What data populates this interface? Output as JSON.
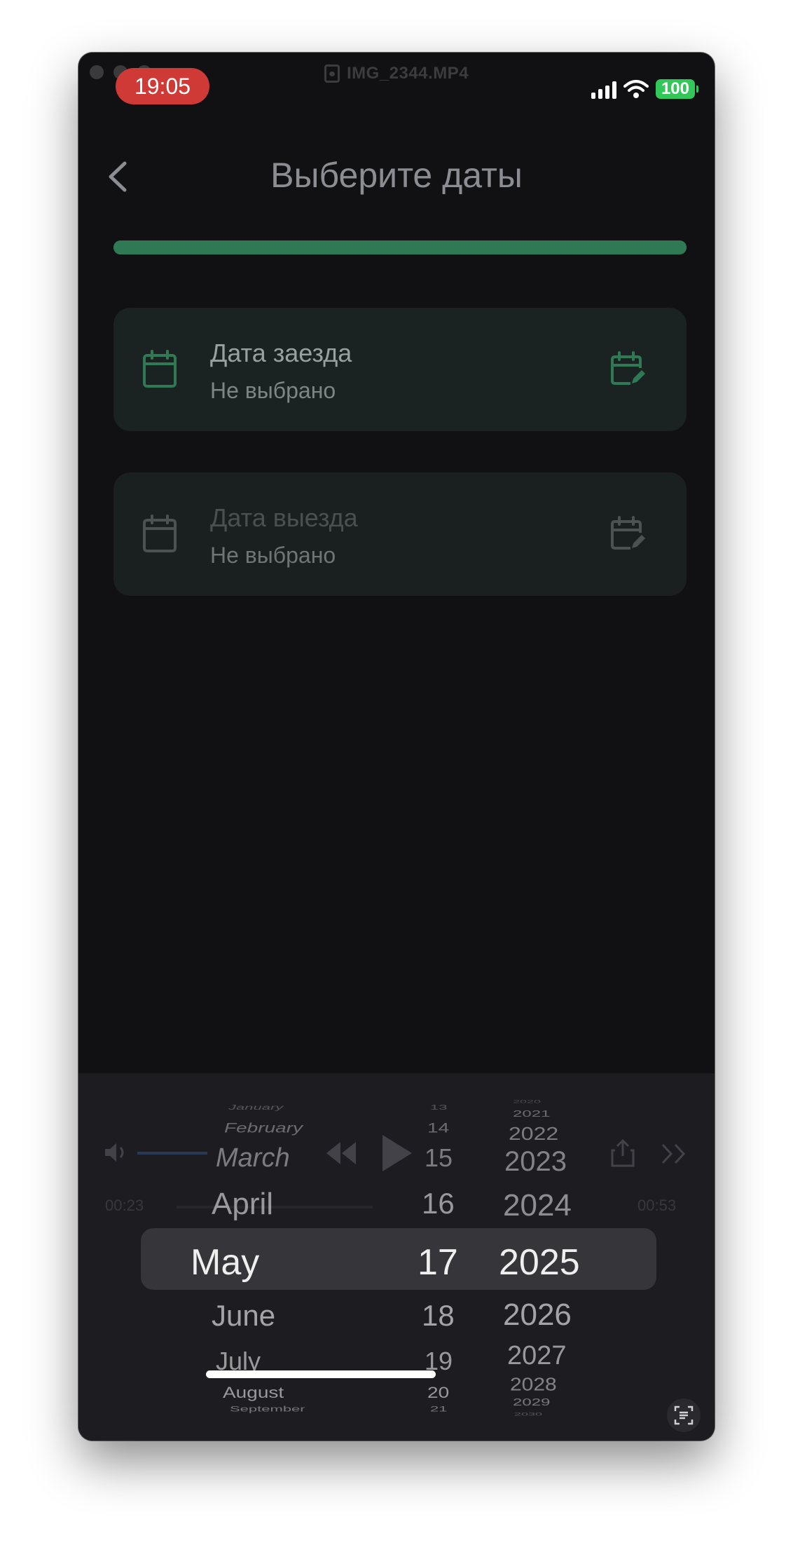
{
  "window": {
    "file_title": "IMG_2344.MP4"
  },
  "status_bar": {
    "time": "19:05",
    "battery": "100"
  },
  "header": {
    "title": "Выберите даты"
  },
  "progress": {
    "fraction": 1.0
  },
  "cards": {
    "checkin": {
      "label": "Дата заезда",
      "value": "Не выбрано",
      "enabled": true
    },
    "checkout": {
      "label": "Дата выезда",
      "value": "Не выбрано",
      "enabled": false
    }
  },
  "player": {
    "elapsed": "00:23",
    "remaining": "00:53"
  },
  "date_picker": {
    "months": [
      "January",
      "February",
      "March",
      "April",
      "May",
      "June",
      "July",
      "August",
      "September"
    ],
    "days": [
      "13",
      "14",
      "15",
      "16",
      "17",
      "18",
      "19",
      "20",
      "21"
    ],
    "years": [
      "2020",
      "2021",
      "2022",
      "2023",
      "2024",
      "2025",
      "2026",
      "2027",
      "2028",
      "2029",
      "2030"
    ],
    "selected": {
      "month": "May",
      "day": "17",
      "year": "2025"
    }
  },
  "colors": {
    "accent_green": "#2f7a55",
    "recording_red": "#d03a36",
    "battery_green": "#32c759"
  }
}
